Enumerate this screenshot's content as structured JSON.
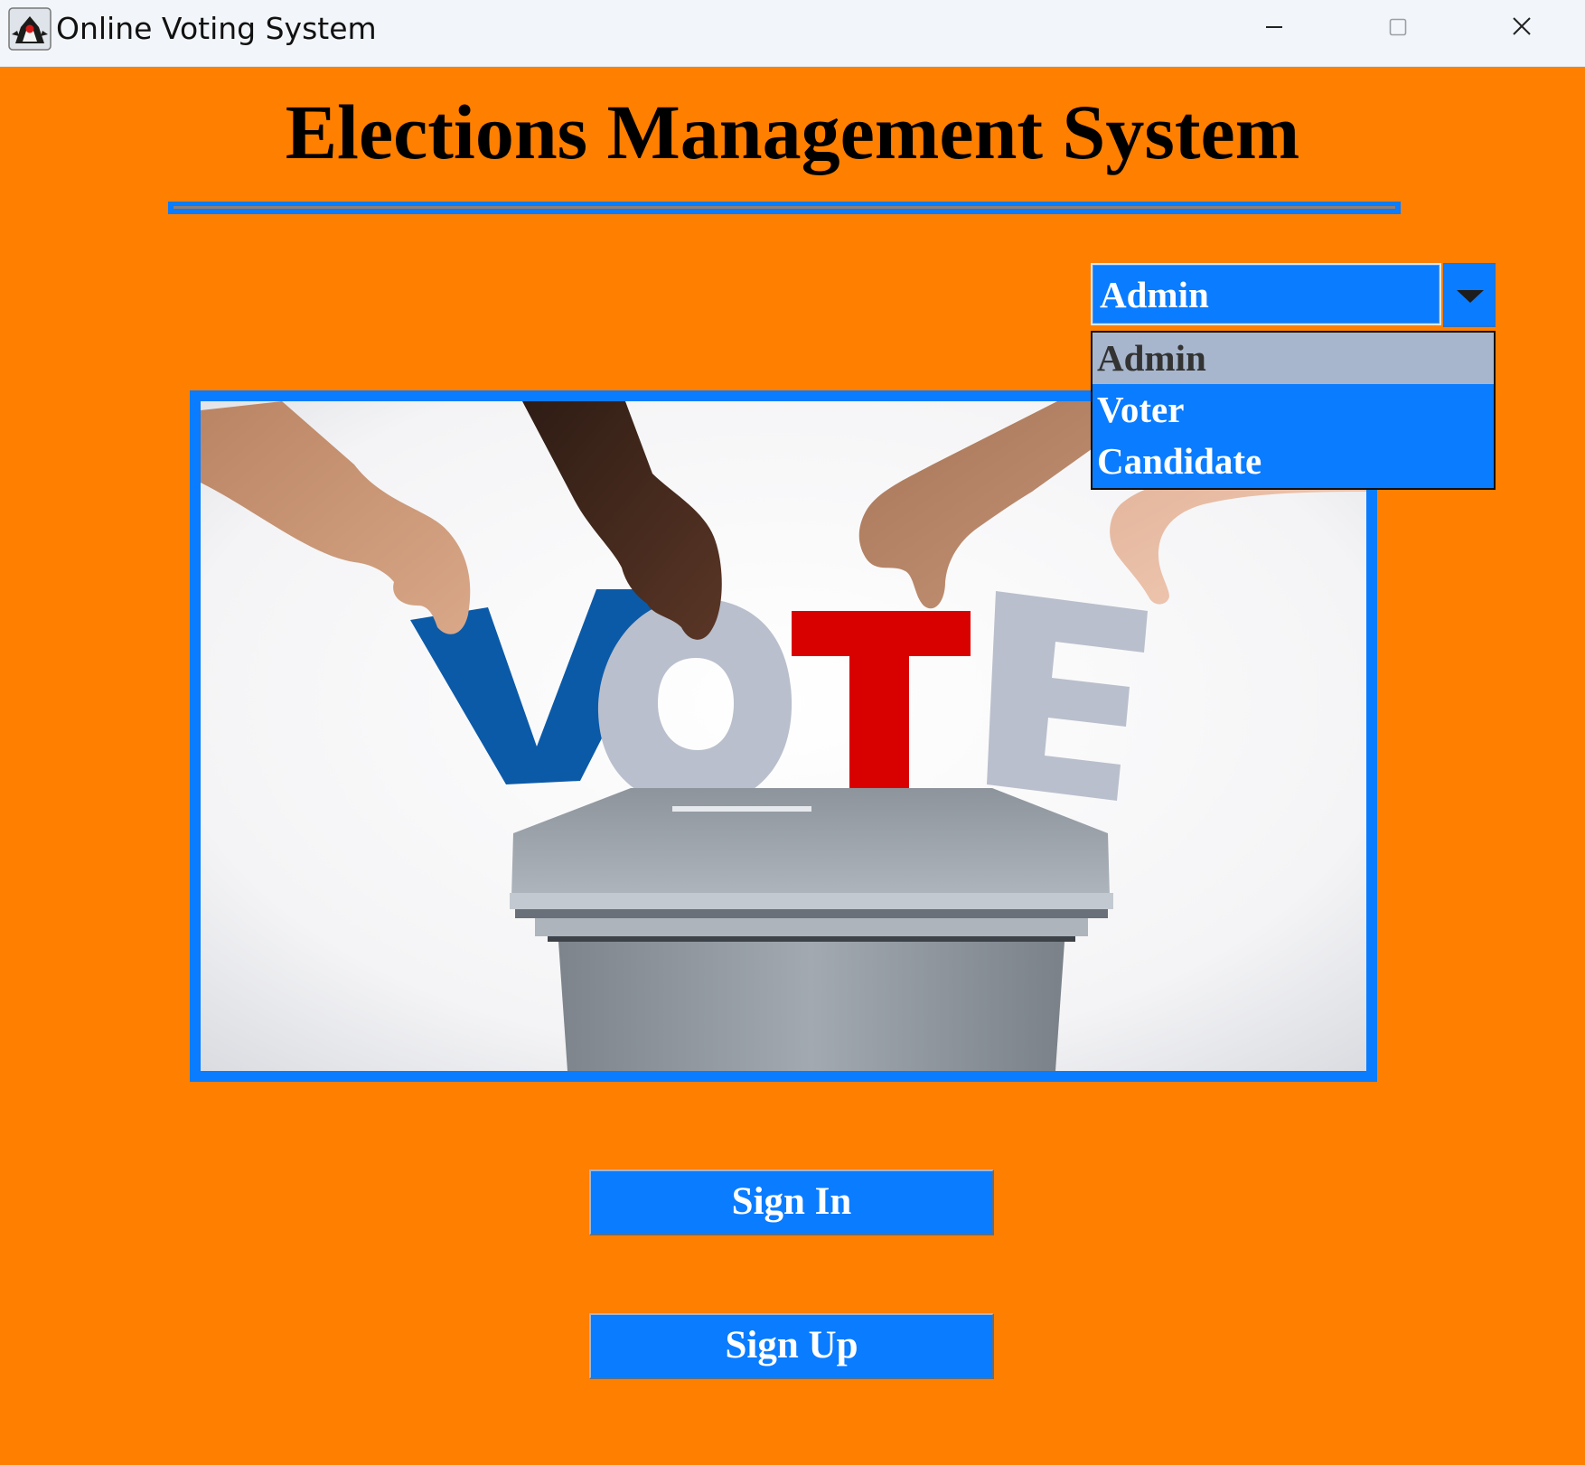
{
  "window": {
    "title": "Online Voting System",
    "icons": {
      "app": "java-duke-icon",
      "minimize": "minimize-icon",
      "maximize": "maximize-icon",
      "close": "close-icon"
    }
  },
  "header": {
    "title": "Elections Management System"
  },
  "role_select": {
    "selected": "Admin",
    "options": [
      "Admin",
      "Voter",
      "Candidate"
    ],
    "highlighted_option": "Admin",
    "expanded": true,
    "icon": "chevron-down-icon"
  },
  "banner_image": {
    "letters": [
      "V",
      "O",
      "T",
      "E"
    ],
    "letter_colors": [
      "#0b5aa8",
      "#b9bfcc",
      "#d90000",
      "#b9bfcc"
    ]
  },
  "actions": {
    "sign_in_label": "Sign In",
    "sign_up_label": "Sign Up"
  },
  "colors": {
    "background": "#ff7f00",
    "accent": "#0a7cff",
    "highlight": "#a7b6cc"
  }
}
